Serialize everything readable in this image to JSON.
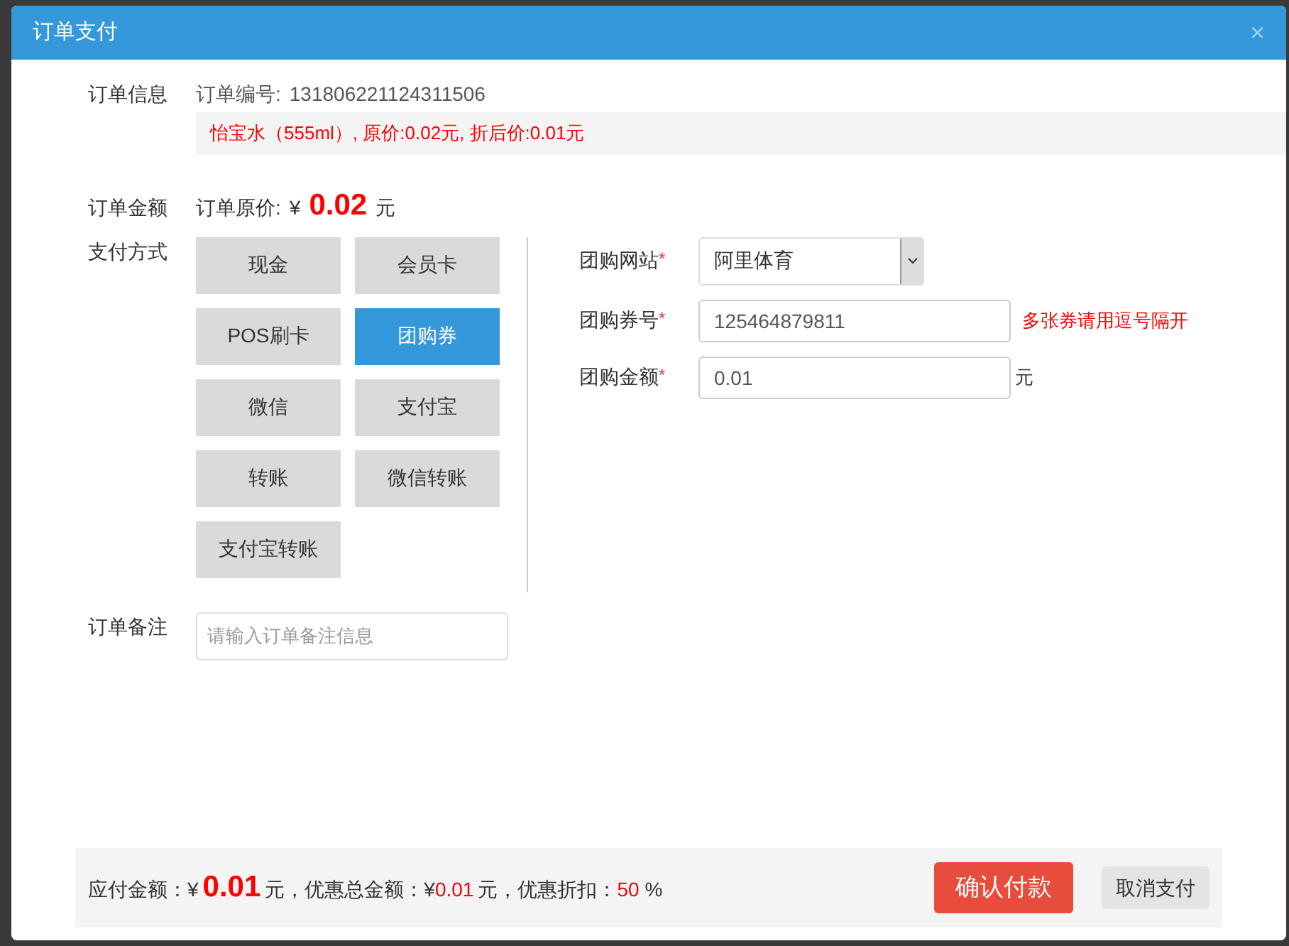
{
  "dialog": {
    "title": "订单支付",
    "close": "×"
  },
  "order_info": {
    "label": "订单信息",
    "number_label": "订单编号:",
    "number": "131806221124311506",
    "product_line": "怡宝水（555ml）, 原价:0.02元, 折后价:0.01元"
  },
  "order_amount": {
    "label": "订单金额",
    "price_label": "订单原价:",
    "currency": "¥",
    "amount": "0.02",
    "unit": "元"
  },
  "payment": {
    "label": "支付方式",
    "methods": [
      {
        "label": "现金",
        "selected": false
      },
      {
        "label": "会员卡",
        "selected": false
      },
      {
        "label": "POS刷卡",
        "selected": false
      },
      {
        "label": "团购券",
        "selected": true
      },
      {
        "label": "微信",
        "selected": false
      },
      {
        "label": "支付宝",
        "selected": false
      },
      {
        "label": "转账",
        "selected": false
      },
      {
        "label": "微信转账",
        "selected": false
      },
      {
        "label": "支付宝转账",
        "selected": false
      }
    ]
  },
  "group_buy": {
    "fields": [
      {
        "kind": "select",
        "label": "团购网站",
        "mark": "*",
        "value": "阿里体育"
      },
      {
        "kind": "input",
        "label": "团购券号",
        "mark": "*",
        "value": "125464879811",
        "hint": "多张券请用逗号隔开"
      },
      {
        "kind": "input",
        "label": "团购金额",
        "mark": "*",
        "value": "0.01",
        "suffix": "元"
      }
    ]
  },
  "remark": {
    "label": "订单备注",
    "placeholder": "请输入订单备注信息"
  },
  "footer": {
    "payable_label": "应付金额：",
    "payable_currency": "¥",
    "payable": "0.01",
    "payable_unit": "元，优惠总金额：",
    "discount_currency": "¥",
    "discount": "0.01",
    "discount_unit": "元，优惠折扣：",
    "rate": "50",
    "rate_unit": "%",
    "confirm": "确认付款",
    "cancel": "取消支付"
  }
}
